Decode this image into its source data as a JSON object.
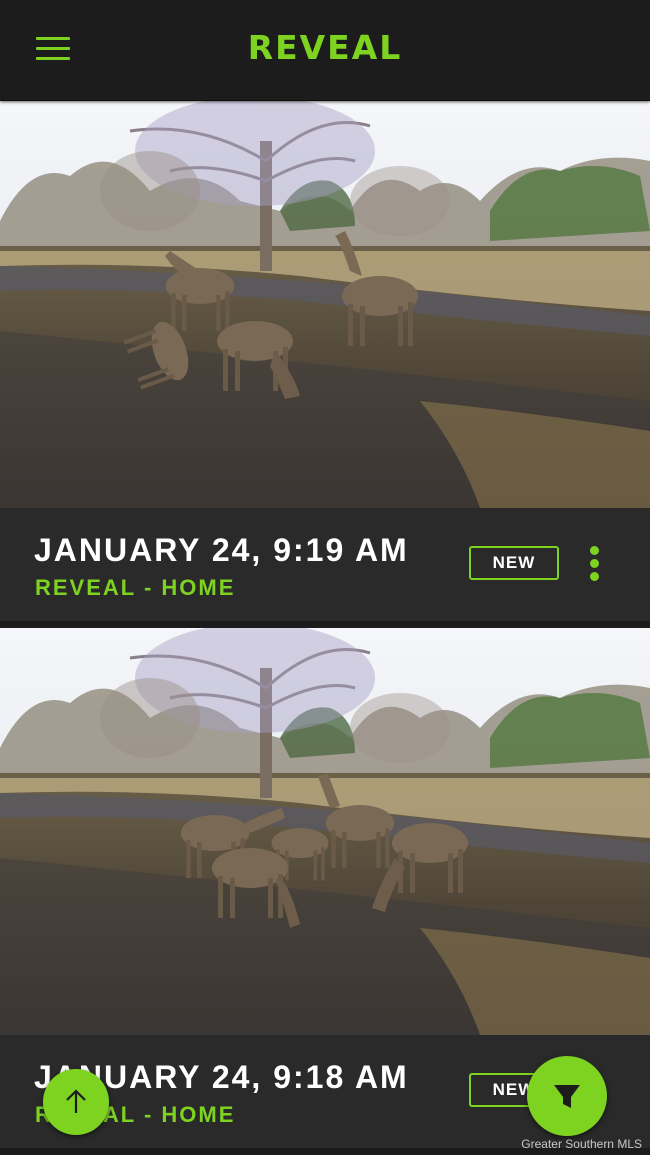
{
  "app": {
    "title": "REVEAL"
  },
  "header": {
    "menu_icon": "hamburger-menu-icon",
    "brand_color": "#7ed321"
  },
  "photos": [
    {
      "date": "JANUARY 24, 9:19 AM",
      "camera": "REVEAL - HOME",
      "badge": "NEW"
    },
    {
      "date": "JANUARY 24, 9:18 AM",
      "camera": "REVEAL - HOME",
      "badge": "NEW"
    }
  ],
  "fabs": {
    "scroll_top_icon": "arrow-up-icon",
    "filter_icon": "filter-funnel-icon"
  },
  "watermark": "Greater Southern MLS",
  "colors": {
    "accent": "#7ed321",
    "bar": "#2a2a2a",
    "header": "#1c1c1c"
  }
}
